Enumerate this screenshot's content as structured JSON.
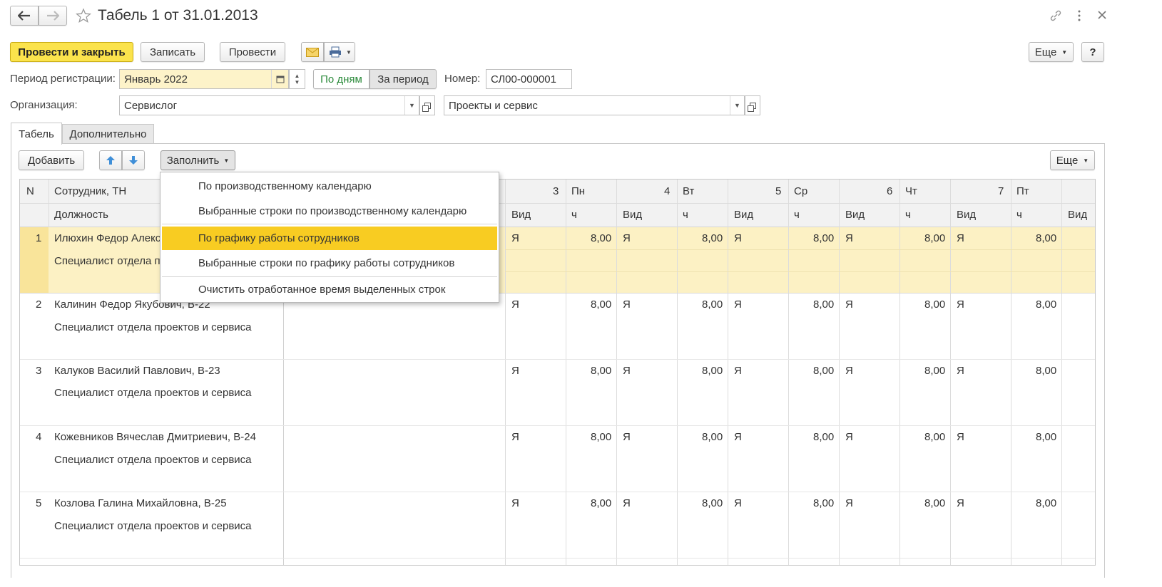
{
  "window": {
    "title": "Табель 1 от 31.01.2013",
    "back_icon": "arrow-left-icon",
    "forward_icon": "arrow-right-icon",
    "star_icon": "star-icon",
    "link_icon": "link-icon",
    "menu_icon": "more-vertical-icon",
    "close_icon": "close-icon"
  },
  "toolbar": {
    "post_close": "Провести и закрыть",
    "save": "Записать",
    "post": "Провести",
    "more": "Еще",
    "help": "?"
  },
  "form": {
    "period_label": "Период регистрации:",
    "period_value": "Январь 2022",
    "by_days": "По дням",
    "for_period": "За период",
    "number_label": "Номер:",
    "number_value": "СЛ00-000001",
    "org_label": "Организация:",
    "org_value": "Сервислог",
    "dept_value": "Проекты и сервис"
  },
  "tabs": [
    "Табель",
    "Дополнительно"
  ],
  "table_toolbar": {
    "add": "Добавить",
    "fill": "Заполнить",
    "more": "Еще"
  },
  "table": {
    "col_n": "N",
    "col_employee": "Сотрудник, ТН",
    "col_position": "Должность",
    "days": [
      {
        "num": "3",
        "dow": "Пн"
      },
      {
        "num": "4",
        "dow": "Вт"
      },
      {
        "num": "5",
        "dow": "Ср"
      },
      {
        "num": "6",
        "dow": "Чт"
      },
      {
        "num": "7",
        "dow": "Пт"
      }
    ],
    "sub_kind": "Вид",
    "sub_hours": "ч",
    "rows": [
      {
        "n": "1",
        "employee": "Илюхин Федор Алексе",
        "position": "Специалист отдела пр",
        "kind": "Я",
        "hours": "8,00"
      },
      {
        "n": "2",
        "employee": "Калинин Федор Якубович, В-22",
        "position": "Специалист отдела проектов и сервиса",
        "kind": "Я",
        "hours": "8,00"
      },
      {
        "n": "3",
        "employee": "Калуков Василий Павлович, В-23",
        "position": "Специалист отдела проектов и сервиса",
        "kind": "Я",
        "hours": "8,00"
      },
      {
        "n": "4",
        "employee": "Кожевников Вячеслав Дмитриевич, В-24",
        "position": "Специалист отдела проектов и сервиса",
        "kind": "Я",
        "hours": "8,00"
      },
      {
        "n": "5",
        "employee": "Козлова Галина Михайловна, В-25",
        "position": "Специалист отдела проектов и сервиса",
        "kind": "Я",
        "hours": "8,00"
      }
    ]
  },
  "fill_menu": {
    "items": [
      "По производственному календарю",
      "Выбранные строки по производственному календарю",
      "По графику работы сотрудников",
      "Выбранные строки по графику работы сотрудников",
      "Очистить отработанное время  выделенных строк"
    ],
    "selected_index": 2
  },
  "colors": {
    "accent_yellow": "#fbe34c",
    "selected_row": "#fcf1c4",
    "menu_highlight": "#f8cc22",
    "green_toggle": "#2a8a3a"
  }
}
